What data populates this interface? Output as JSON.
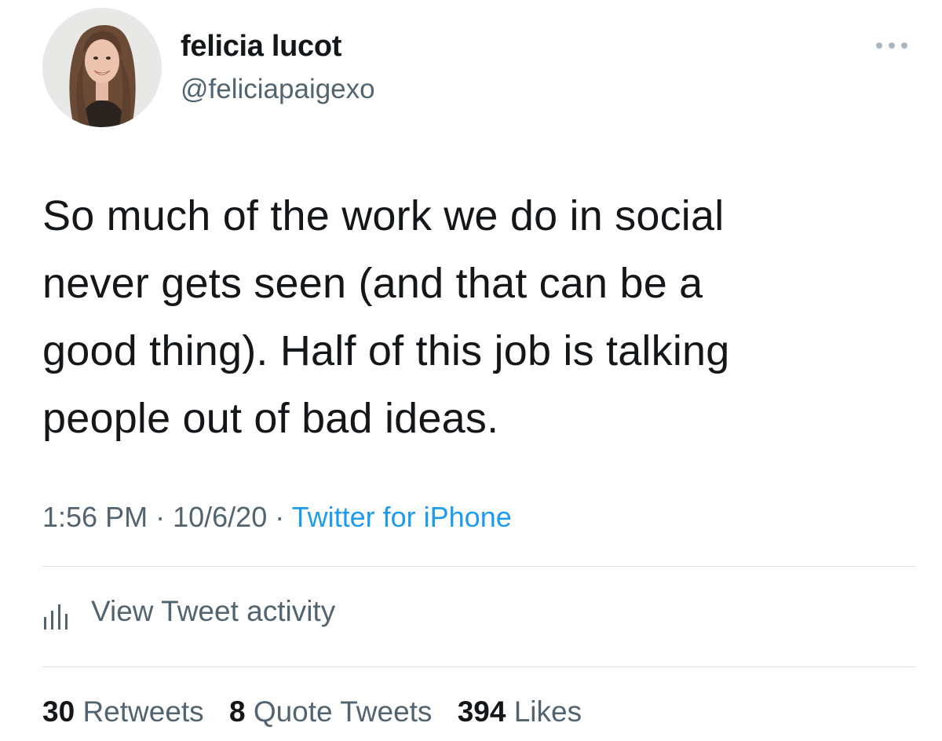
{
  "author": {
    "display_name": "felicia lucot",
    "handle": "@feliciapaigexo",
    "avatar_icon": "profile-photo"
  },
  "more_icon": "ellipsis-icon",
  "tweet": {
    "lines": [
      "So much of the work we do in social",
      "never gets seen (and that can be a",
      "good thing). Half of this job is talking",
      "people out of bad ideas."
    ]
  },
  "meta": {
    "time": "1:56 PM",
    "separator": "·",
    "date": "10/6/20",
    "source": "Twitter for iPhone"
  },
  "activity": {
    "label": "View Tweet activity",
    "icon": "bar-chart-icon"
  },
  "stats": {
    "retweets_count": "30",
    "retweets_label": "Retweets",
    "quotes_count": "8",
    "quotes_label": "Quote Tweets",
    "likes_count": "394",
    "likes_label": "Likes"
  },
  "colors": {
    "text_primary": "#14171a",
    "text_secondary": "#536471",
    "link": "#1d9bf0",
    "divider": "#dcdfe2"
  }
}
